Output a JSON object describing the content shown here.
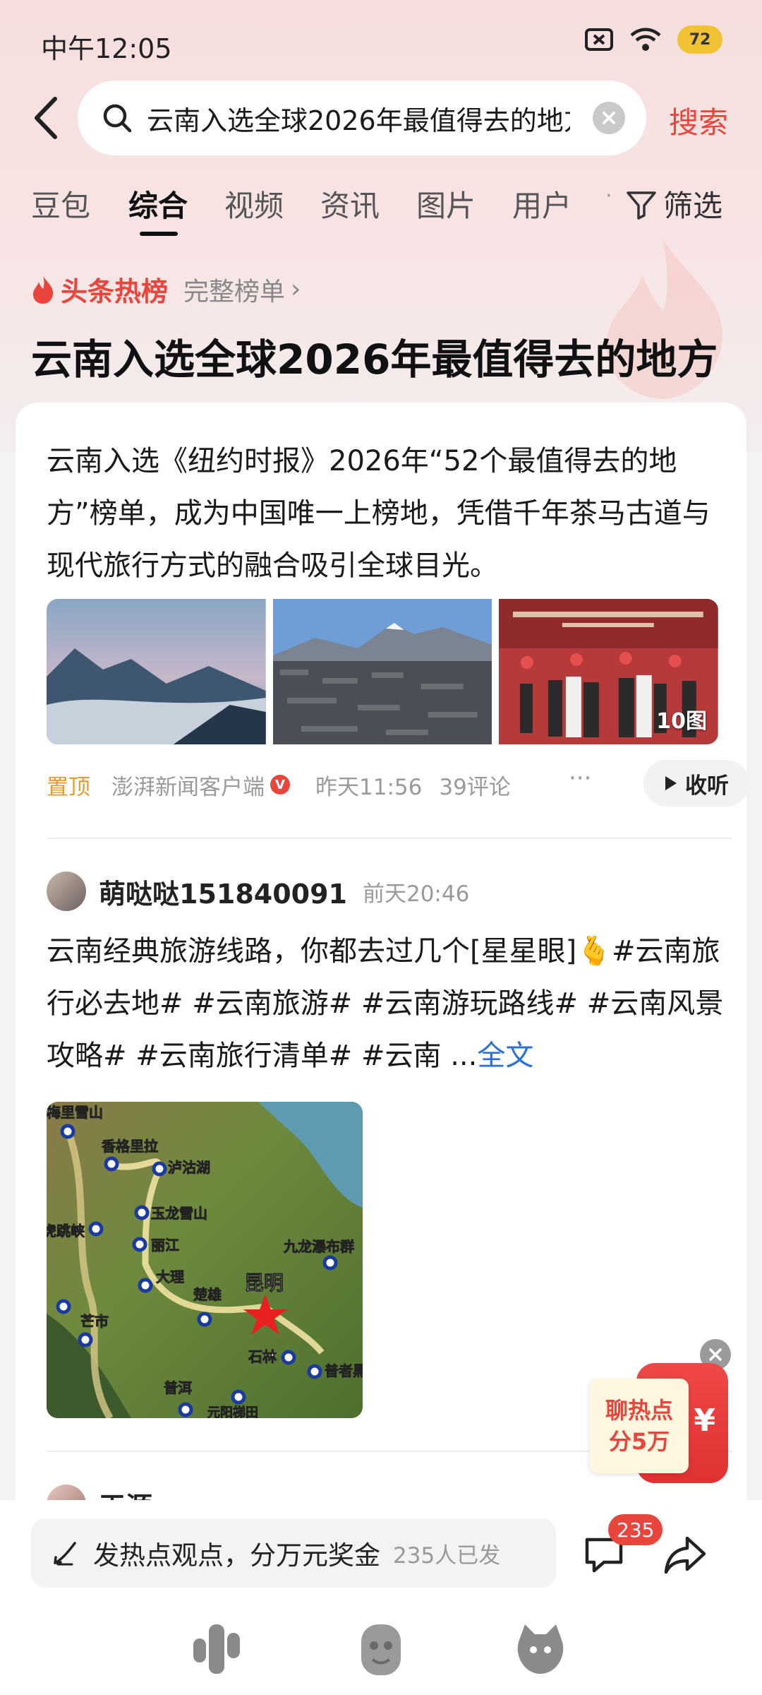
{
  "status_bar": {
    "time": "中午12:05",
    "battery": "72"
  },
  "search": {
    "query": "云南入选全球2026年最值得去的地方",
    "button_label": "搜索"
  },
  "tabs": [
    {
      "label": "豆包"
    },
    {
      "label": "综合"
    },
    {
      "label": "视频"
    },
    {
      "label": "资讯"
    },
    {
      "label": "图片"
    },
    {
      "label": "用户"
    }
  ],
  "filter_label": "筛选",
  "hot_list": {
    "label": "头条热榜",
    "full_list": "完整榜单",
    "title": "云南入选全球2026年最值得去的地方"
  },
  "article": {
    "text": "云南入选《纽约时报》2026年“52个最值得去的地方”榜单，成为中国唯一上榜地，凭借千年茶马古道与现代旅行方式的融合吸引全球目光。",
    "image_count": "10图",
    "pin_label": "置顶",
    "source": "澎湃新闻客户端",
    "verified_badge": "V",
    "time": "昨天11:56",
    "comments": "39评论",
    "more": "···",
    "listen_label": "收听"
  },
  "post": {
    "username": "萌哒哒151840091",
    "time": "前天20:46",
    "text": "云南经典旅游线路，你都去过几个[星星眼]🫰#云南旅行必去地# #云南旅游# #云南游玩路线# #云南风景攻略# #云南旅行清单# #云南 ...",
    "more_label": "全文",
    "map_labels": [
      "梅里雪山",
      "香格里拉",
      "泸沽湖",
      "玉龙雪山",
      "虎跳峡",
      "丽江",
      "大理",
      "九龙瀑布群",
      "楚雄",
      "昆明",
      "芒市",
      "石林",
      "普者黑",
      "普洱",
      "元阳梯田"
    ]
  },
  "next_post": {
    "username": "王源"
  },
  "promo": {
    "line1": "聊热点",
    "line2": "分5万",
    "symbol": "¥"
  },
  "bottom_bar": {
    "placeholder": "发热点观点，分万元奖金",
    "count": "235人已发",
    "comment_badge": "235"
  },
  "colors": {
    "accent_red": "#e8453c",
    "link_blue": "#2a6fdb",
    "pin_orange": "#e89a2c"
  }
}
